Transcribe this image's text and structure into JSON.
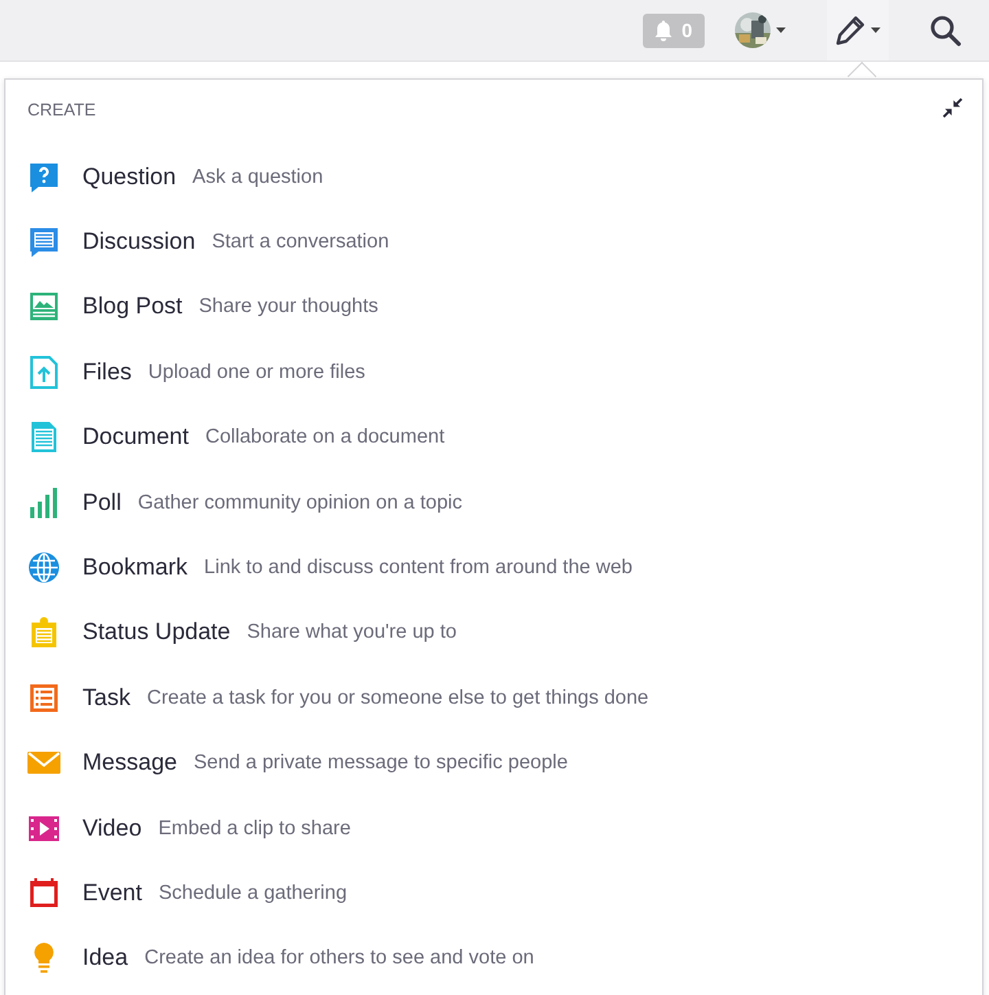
{
  "top_bar": {
    "notifications": {
      "count": "0"
    }
  },
  "create_menu": {
    "heading": "CREATE",
    "items": [
      {
        "kind": "question",
        "title": "Question",
        "description": "Ask a question"
      },
      {
        "kind": "discussion",
        "title": "Discussion",
        "description": "Start a conversation"
      },
      {
        "kind": "blog",
        "title": "Blog Post",
        "description": "Share your thoughts"
      },
      {
        "kind": "files",
        "title": "Files",
        "description": "Upload one or more files"
      },
      {
        "kind": "document",
        "title": "Document",
        "description": "Collaborate on a document"
      },
      {
        "kind": "poll",
        "title": "Poll",
        "description": "Gather community opinion on a topic"
      },
      {
        "kind": "bookmark",
        "title": "Bookmark",
        "description": "Link to and discuss content from around the web"
      },
      {
        "kind": "status",
        "title": "Status Update",
        "description": "Share what you're up to"
      },
      {
        "kind": "task",
        "title": "Task",
        "description": "Create a task for you or someone else to get things done"
      },
      {
        "kind": "message",
        "title": "Message",
        "description": "Send a private message to specific people"
      },
      {
        "kind": "video",
        "title": "Video",
        "description": "Embed a clip to share"
      },
      {
        "kind": "event",
        "title": "Event",
        "description": "Schedule a gathering"
      },
      {
        "kind": "idea",
        "title": "Idea",
        "description": "Create an idea for others to see and vote on"
      }
    ]
  }
}
